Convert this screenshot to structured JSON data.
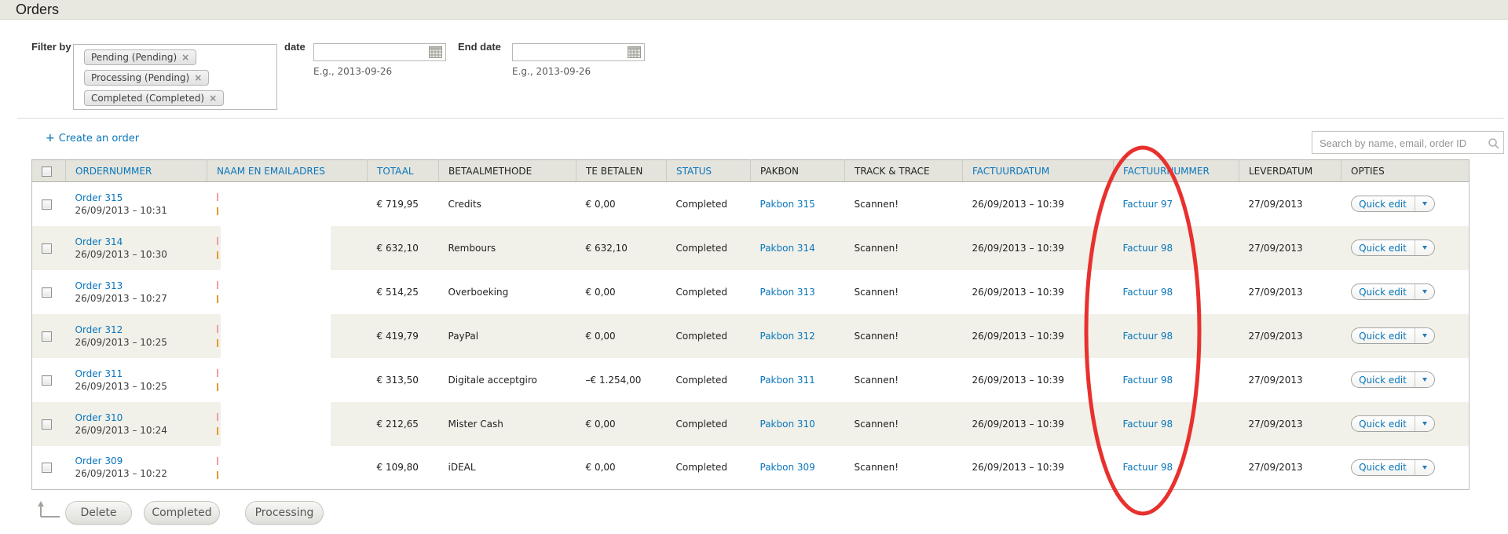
{
  "page_title": "Orders",
  "filter": {
    "label": "Filter by",
    "tags": [
      {
        "label": "Pending (Pending)",
        "remove": "×"
      },
      {
        "label": "Processing (Pending)",
        "remove": "×"
      },
      {
        "label": "Completed (Completed)",
        "remove": "×"
      }
    ],
    "date_label": "date",
    "date_hint": "E.g., 2013-09-26",
    "end_date_label": "End date",
    "end_date_hint": "E.g., 2013-09-26"
  },
  "actions": {
    "plus": "+",
    "create_order": "Create an order"
  },
  "search": {
    "placeholder": "Search by name, email, order ID"
  },
  "table": {
    "quick_edit_label": "Quick edit",
    "headers": [
      {
        "label": "",
        "sortable": false
      },
      {
        "label": "ORDERNUMMER",
        "sortable": true
      },
      {
        "label": "NAAM EN EMAILADRES",
        "sortable": true
      },
      {
        "label": "TOTAAL",
        "sortable": true
      },
      {
        "label": "BETAALMETHODE",
        "sortable": false
      },
      {
        "label": "TE BETALEN",
        "sortable": false
      },
      {
        "label": "STATUS",
        "sortable": true
      },
      {
        "label": "PAKBON",
        "sortable": false
      },
      {
        "label": "TRACK & TRACE",
        "sortable": false
      },
      {
        "label": "FACTUURDATUM",
        "sortable": true
      },
      {
        "label": "FACTUURNUMMER",
        "sortable": true
      },
      {
        "label": "LEVERDATUM",
        "sortable": false
      },
      {
        "label": "OPTIES",
        "sortable": false
      }
    ],
    "rows": [
      {
        "order": "Order 315",
        "order_date": "26/09/2013 – 10:31",
        "total": "€ 719,95",
        "method": "Credits",
        "due": "€ 0,00",
        "status": "Completed",
        "pakbon": "Pakbon 315",
        "track": "Scannen!",
        "invoice_date": "26/09/2013 – 10:39",
        "invoice": "Factuur 97",
        "delivery": "27/09/2013"
      },
      {
        "order": "Order 314",
        "order_date": "26/09/2013 – 10:30",
        "total": "€ 632,10",
        "method": "Rembours",
        "due": "€ 632,10",
        "status": "Completed",
        "pakbon": "Pakbon 314",
        "track": "Scannen!",
        "invoice_date": "26/09/2013 – 10:39",
        "invoice": "Factuur 98",
        "delivery": "27/09/2013"
      },
      {
        "order": "Order 313",
        "order_date": "26/09/2013 – 10:27",
        "total": "€ 514,25",
        "method": "Overboeking",
        "due": "€ 0,00",
        "status": "Completed",
        "pakbon": "Pakbon 313",
        "track": "Scannen!",
        "invoice_date": "26/09/2013 – 10:39",
        "invoice": "Factuur 98",
        "delivery": "27/09/2013"
      },
      {
        "order": "Order 312",
        "order_date": "26/09/2013 – 10:25",
        "total": "€ 419,79",
        "method": "PayPal",
        "due": "€ 0,00",
        "status": "Completed",
        "pakbon": "Pakbon 312",
        "track": "Scannen!",
        "invoice_date": "26/09/2013 – 10:39",
        "invoice": "Factuur 98",
        "delivery": "27/09/2013"
      },
      {
        "order": "Order 311",
        "order_date": "26/09/2013 – 10:25",
        "total": "€ 313,50",
        "method": "Digitale acceptgiro",
        "due": "–€ 1.254,00",
        "status": "Completed",
        "pakbon": "Pakbon 311",
        "track": "Scannen!",
        "invoice_date": "26/09/2013 – 10:39",
        "invoice": "Factuur 98",
        "delivery": "27/09/2013"
      },
      {
        "order": "Order 310",
        "order_date": "26/09/2013 – 10:24",
        "total": "€ 212,65",
        "method": "Mister Cash",
        "due": "€ 0,00",
        "status": "Completed",
        "pakbon": "Pakbon 310",
        "track": "Scannen!",
        "invoice_date": "26/09/2013 – 10:39",
        "invoice": "Factuur 98",
        "delivery": "27/09/2013"
      },
      {
        "order": "Order 309",
        "order_date": "26/09/2013 – 10:22",
        "total": "€ 109,80",
        "method": "iDEAL",
        "due": "€ 0,00",
        "status": "Completed",
        "pakbon": "Pakbon 309",
        "track": "Scannen!",
        "invoice_date": "26/09/2013 – 10:39",
        "invoice": "Factuur 98",
        "delivery": "27/09/2013"
      }
    ]
  },
  "footer": {
    "buttons": [
      {
        "label": "Delete"
      },
      {
        "label": "Completed"
      },
      {
        "label": "Processing"
      }
    ]
  },
  "annotation": {
    "shape": "ellipse",
    "color": "#e8312e"
  }
}
